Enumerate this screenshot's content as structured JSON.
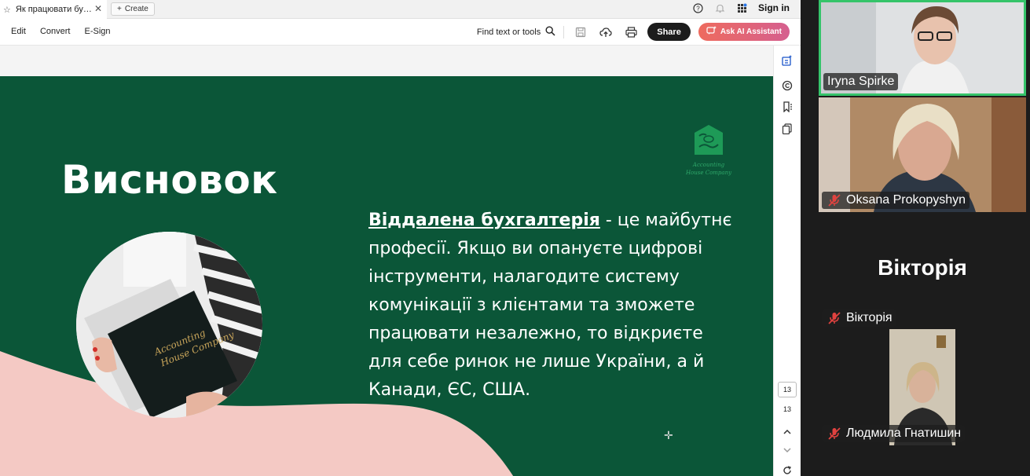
{
  "tabs": {
    "active_title": "Як працювати бухгал...",
    "create_label": "Create"
  },
  "header": {
    "signin_label": "Sign in"
  },
  "menu": {
    "items": [
      "Edit",
      "Convert",
      "E-Sign"
    ]
  },
  "tools": {
    "find_label": "Find text or tools",
    "share_label": "Share",
    "ai_label": "Ask AI Assistant"
  },
  "slide": {
    "title": "Висновок",
    "highlight": "Віддалена бухгалтерія",
    "lines": [
      " - це майбутнє",
      "професії. Якщо ви опануєте цифрові",
      "інструменти, налагодите систему",
      "комунікації з клієнтами та зможете",
      "працювати незалежно, то відкриєте",
      "для себе ринок не лише України, а й",
      "Канади, ЄС, США."
    ],
    "logo_line1": "Accounting",
    "logo_line2": "House Company",
    "folder_line1": "Accounting",
    "folder_line2": "House Company"
  },
  "pager": {
    "current": "13",
    "total": "13"
  },
  "participants": [
    {
      "name": "Iryna Spirke",
      "muted": false
    },
    {
      "name": "Oksana Prokopyshyn",
      "muted": true
    },
    {
      "name": "Вікторія",
      "muted": true
    },
    {
      "name": "Людмила Гнатишин",
      "muted": true
    }
  ],
  "colors": {
    "slide_bg": "#0b5638",
    "pink": "#f4c9c4",
    "active_speaker": "#35c46a",
    "mute_red": "#e0423f"
  }
}
